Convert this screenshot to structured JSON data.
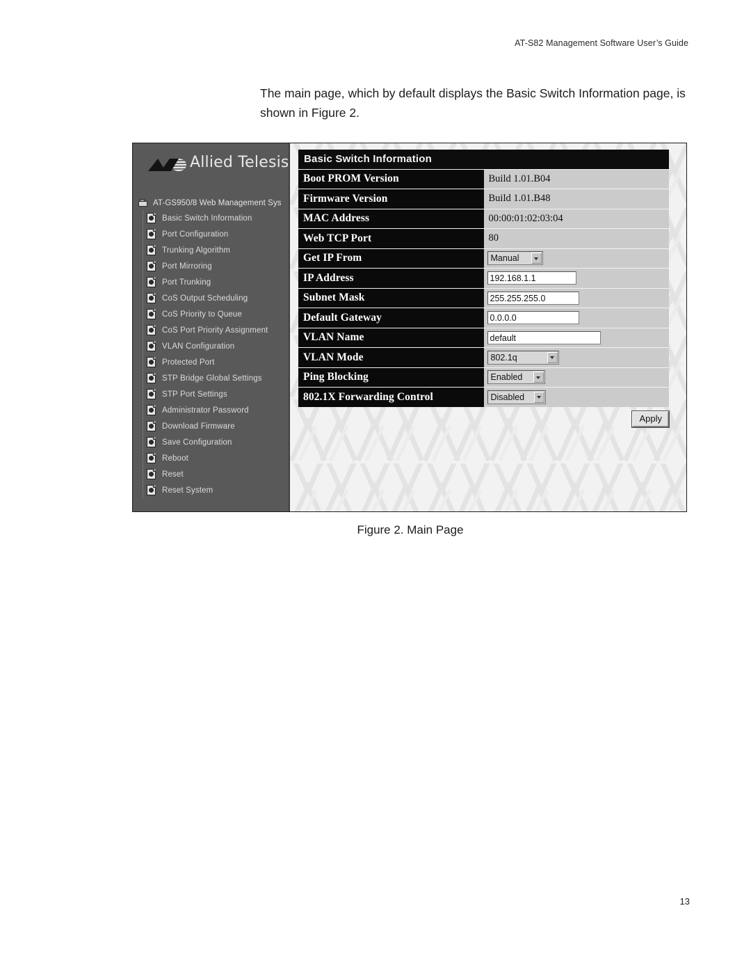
{
  "document": {
    "header": "AT-S82 Management Software User’s Guide",
    "body_paragraph": "The main page, which by default displays the Basic Switch Information page, is shown in Figure 2.",
    "figure_caption": "Figure 2. Main Page",
    "page_number": "13"
  },
  "figure": {
    "sidebar": {
      "logo_text": "Allied Telesis",
      "logo_icon": "allied-telesis-wedge-logo",
      "tree_root": {
        "icon": "switch-device-icon",
        "label": "AT-GS950/8 Web Management Sys"
      },
      "items": [
        {
          "icon": "page-icon",
          "label": "Basic Switch Information"
        },
        {
          "icon": "page-icon",
          "label": "Port Configuration"
        },
        {
          "icon": "page-icon",
          "label": "Trunking Algorithm"
        },
        {
          "icon": "page-icon",
          "label": "Port Mirroring"
        },
        {
          "icon": "page-icon",
          "label": "Port Trunking"
        },
        {
          "icon": "page-icon",
          "label": "CoS Output Scheduling"
        },
        {
          "icon": "page-icon",
          "label": "CoS Priority to Queue"
        },
        {
          "icon": "page-icon",
          "label": "CoS Port Priority Assignment"
        },
        {
          "icon": "page-icon",
          "label": "VLAN Configuration"
        },
        {
          "icon": "page-icon",
          "label": "Protected Port"
        },
        {
          "icon": "page-icon",
          "label": "STP Bridge Global Settings"
        },
        {
          "icon": "page-icon",
          "label": "STP Port Settings"
        },
        {
          "icon": "page-icon",
          "label": "Administrator Password"
        },
        {
          "icon": "page-icon",
          "label": "Download Firmware"
        },
        {
          "icon": "page-icon",
          "label": "Save Configuration"
        },
        {
          "icon": "page-icon",
          "label": "Reboot"
        },
        {
          "icon": "page-icon",
          "label": "Reset"
        },
        {
          "icon": "page-icon",
          "label": "Reset System"
        }
      ]
    },
    "content": {
      "panel_title": "Basic Switch Information",
      "rows": [
        {
          "label": "Boot PROM Version",
          "type": "text",
          "value": "Build 1.01.B04"
        },
        {
          "label": "Firmware Version",
          "type": "text",
          "value": "Build 1.01.B48"
        },
        {
          "label": "MAC Address",
          "type": "text",
          "value": "00:00:01:02:03:04"
        },
        {
          "label": "Web TCP Port",
          "type": "text",
          "value": "80"
        },
        {
          "label": "Get IP From",
          "type": "select",
          "value": "Manual"
        },
        {
          "label": "IP Address",
          "type": "input",
          "value": "192.168.1.1"
        },
        {
          "label": "Subnet Mask",
          "type": "input",
          "value": "255.255.255.0"
        },
        {
          "label": "Default Gateway",
          "type": "input",
          "value": "0.0.0.0"
        },
        {
          "label": "VLAN Name",
          "type": "input",
          "value": "default"
        },
        {
          "label": "VLAN Mode",
          "type": "select",
          "value": "802.1q"
        },
        {
          "label": "Ping Blocking",
          "type": "select",
          "value": "Enabled"
        },
        {
          "label": "802.1X Forwarding Control",
          "type": "select",
          "value": "Disabled"
        }
      ],
      "apply_label": "Apply"
    }
  },
  "colors": {
    "sidebar_bg": "#595959",
    "label_cell_bg": "#0a0a0a",
    "value_cell_bg": "#cbcbcb",
    "panel_title_bg": "#0d0d0d",
    "content_bg": "#f2f2f2"
  }
}
